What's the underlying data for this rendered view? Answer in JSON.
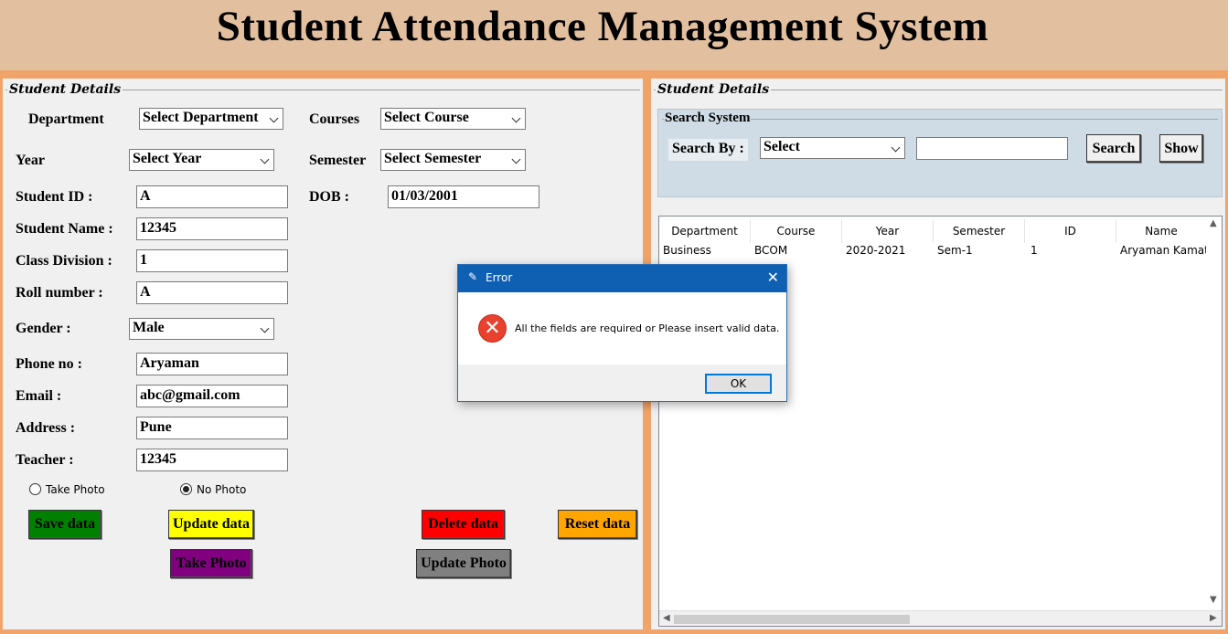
{
  "app": {
    "title": "Student Attendance Management System"
  },
  "left_panel": {
    "title": "Student Details",
    "labels": {
      "department": "Department",
      "courses": "Courses",
      "year": "Year",
      "semester": "Semester",
      "student_id": "Student ID :",
      "dob": "DOB :",
      "student_name": "Student Name :",
      "class_division": "Class Division :",
      "roll_number": "Roll number :",
      "gender": "Gender :",
      "phone": "Phone no :",
      "email": "Email :",
      "address": "Address :",
      "teacher": "Teacher :"
    },
    "selects": {
      "department": "Select Department",
      "course": "Select Course",
      "year": "Select Year",
      "semester": "Select Semester",
      "gender": "Male"
    },
    "inputs": {
      "student_id": "A",
      "dob": "01/03/2001",
      "student_name": "12345",
      "class_division": "1",
      "roll_number": "A",
      "phone": "Aryaman",
      "email": "abc@gmail.com",
      "address": "Pune",
      "teacher": "12345"
    },
    "radios": {
      "take_photo": "Take Photo",
      "no_photo": "No Photo",
      "selected": "no_photo"
    },
    "buttons": {
      "save": "Save data",
      "update": "Update data",
      "delete": "Delete data",
      "reset": "Reset data",
      "take_photo": "Take Photo",
      "update_photo": "Update Photo"
    }
  },
  "right_panel": {
    "title": "Student Details",
    "search": {
      "frame_title": "Search System",
      "search_by_label": "Search By :",
      "select_value": "Select",
      "input_value": "",
      "search_button": "Search",
      "show_button": "Show"
    },
    "table": {
      "columns": [
        "Department",
        "Course",
        "Year",
        "Semester",
        "ID",
        "Name"
      ],
      "rows": [
        [
          "Business",
          "BCOM",
          "2020-2021",
          "Sem-1",
          "1",
          "Aryaman Kamat"
        ]
      ]
    }
  },
  "dialog": {
    "title": "Error",
    "message": "All the fields are required or Please insert valid data.",
    "ok_label": "OK",
    "close_glyph": "✕",
    "icon": "error-icon"
  },
  "colors": {
    "header_bg": "#e2bf9f",
    "frame_bg": "#f1a46a",
    "save_btn": "#008000",
    "update_btn": "#ffff00",
    "delete_btn": "#ff0000",
    "reset_btn": "#ffa500",
    "take_photo_btn": "#800080",
    "update_photo_btn": "#808080",
    "search_frame": "#d0dce5",
    "dialog_titlebar": "#0f5fb3",
    "error_red": "#e8412d"
  }
}
